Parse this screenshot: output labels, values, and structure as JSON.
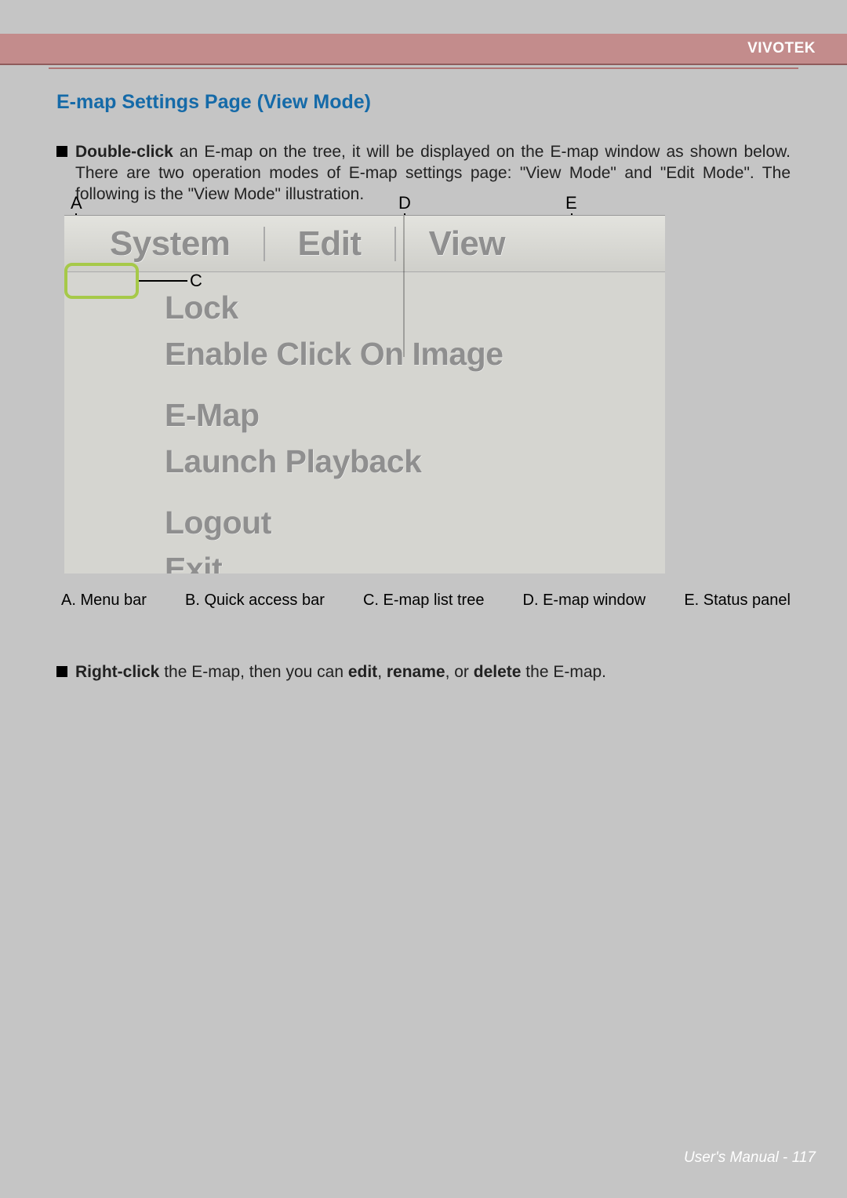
{
  "brand": "VIVOTEK",
  "section_title": "E-map Settings Page (View Mode)",
  "para1_prefix": "Double-click",
  "para1_rest": " an E-map on the tree, it will be displayed on the E-map window as shown below. There are two operation modes of E-map settings page: \"View Mode\" and \"Edit Mode\". The following is the \"View Mode\" illustration.",
  "callouts": {
    "A": "A",
    "C": "C",
    "D": "D",
    "E": "E"
  },
  "menubar": {
    "system": "System",
    "edit": "Edit",
    "view": "View"
  },
  "menu_items": {
    "lock": "Lock",
    "enable": "Enable Click On Image",
    "emap": "E-Map",
    "launch": "Launch Playback",
    "logout": "Logout",
    "exit": "Exit"
  },
  "legend": {
    "a": "A. Menu bar",
    "b": "B. Quick access bar",
    "c": "C. E-map list tree",
    "d": "D. E-map window",
    "e": "E. Status panel"
  },
  "para2_prefix": "Right-click",
  "para2_mid1": " the E-map, then you can ",
  "para2_edit": "edit",
  "para2_mid2": ", ",
  "para2_rename": "rename",
  "para2_mid3": ", or ",
  "para2_delete": "delete",
  "para2_end": " the E-map.",
  "footer_label": "User's Manual",
  "footer_page": "117"
}
